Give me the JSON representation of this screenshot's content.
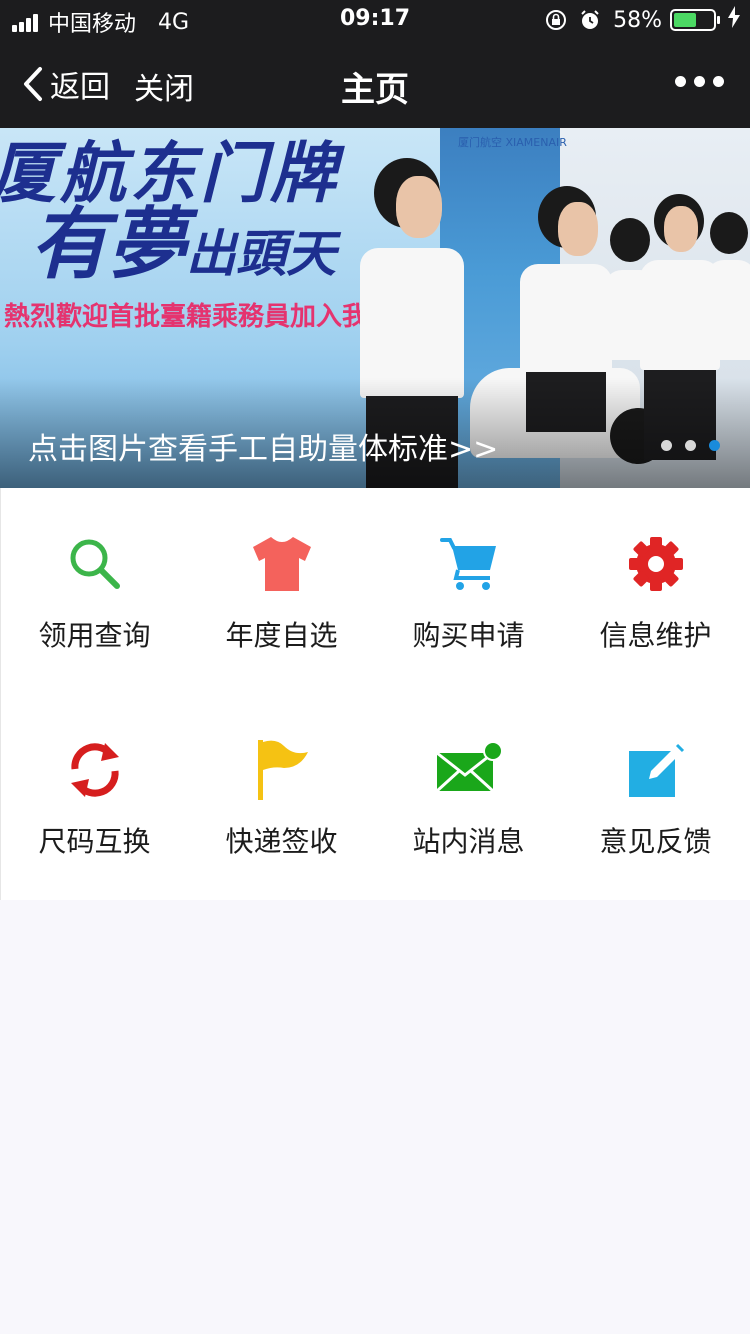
{
  "status_bar": {
    "carrier": "中国移动",
    "network": "4G",
    "time": "09:17",
    "battery_percent": "58%",
    "battery_level": 0.58
  },
  "nav": {
    "back_label": "返回",
    "close_label": "关闭",
    "title": "主页"
  },
  "banner": {
    "slogan_line1": "厦航东门牌",
    "slogan_line2": "有夢",
    "slogan_line2_small": "出頭天",
    "welcome_text": "熱烈歡迎首批臺籍乘務員加入我們!",
    "brand_text": "厦门航空 XIAMENAIR",
    "caption": "点击图片查看手工自助量体标准>>",
    "slide_count": 3,
    "active_slide": 3
  },
  "menu": {
    "items": [
      {
        "label": "领用查询",
        "icon": "search-icon",
        "color": "#3cb54a"
      },
      {
        "label": "年度自选",
        "icon": "shirt-icon",
        "color": "#f4625c"
      },
      {
        "label": "购买申请",
        "icon": "cart-icon",
        "color": "#22a3e6"
      },
      {
        "label": "信息维护",
        "icon": "gear-icon",
        "color": "#e02525"
      },
      {
        "label": "尺码互换",
        "icon": "refresh-icon",
        "color": "#d61e1e"
      },
      {
        "label": "快递签收",
        "icon": "flag-icon",
        "color": "#f5c213"
      },
      {
        "label": "站内消息",
        "icon": "mail-icon",
        "color": "#1aa71a"
      },
      {
        "label": "意见反馈",
        "icon": "edit-icon",
        "color": "#22aee3"
      }
    ]
  }
}
